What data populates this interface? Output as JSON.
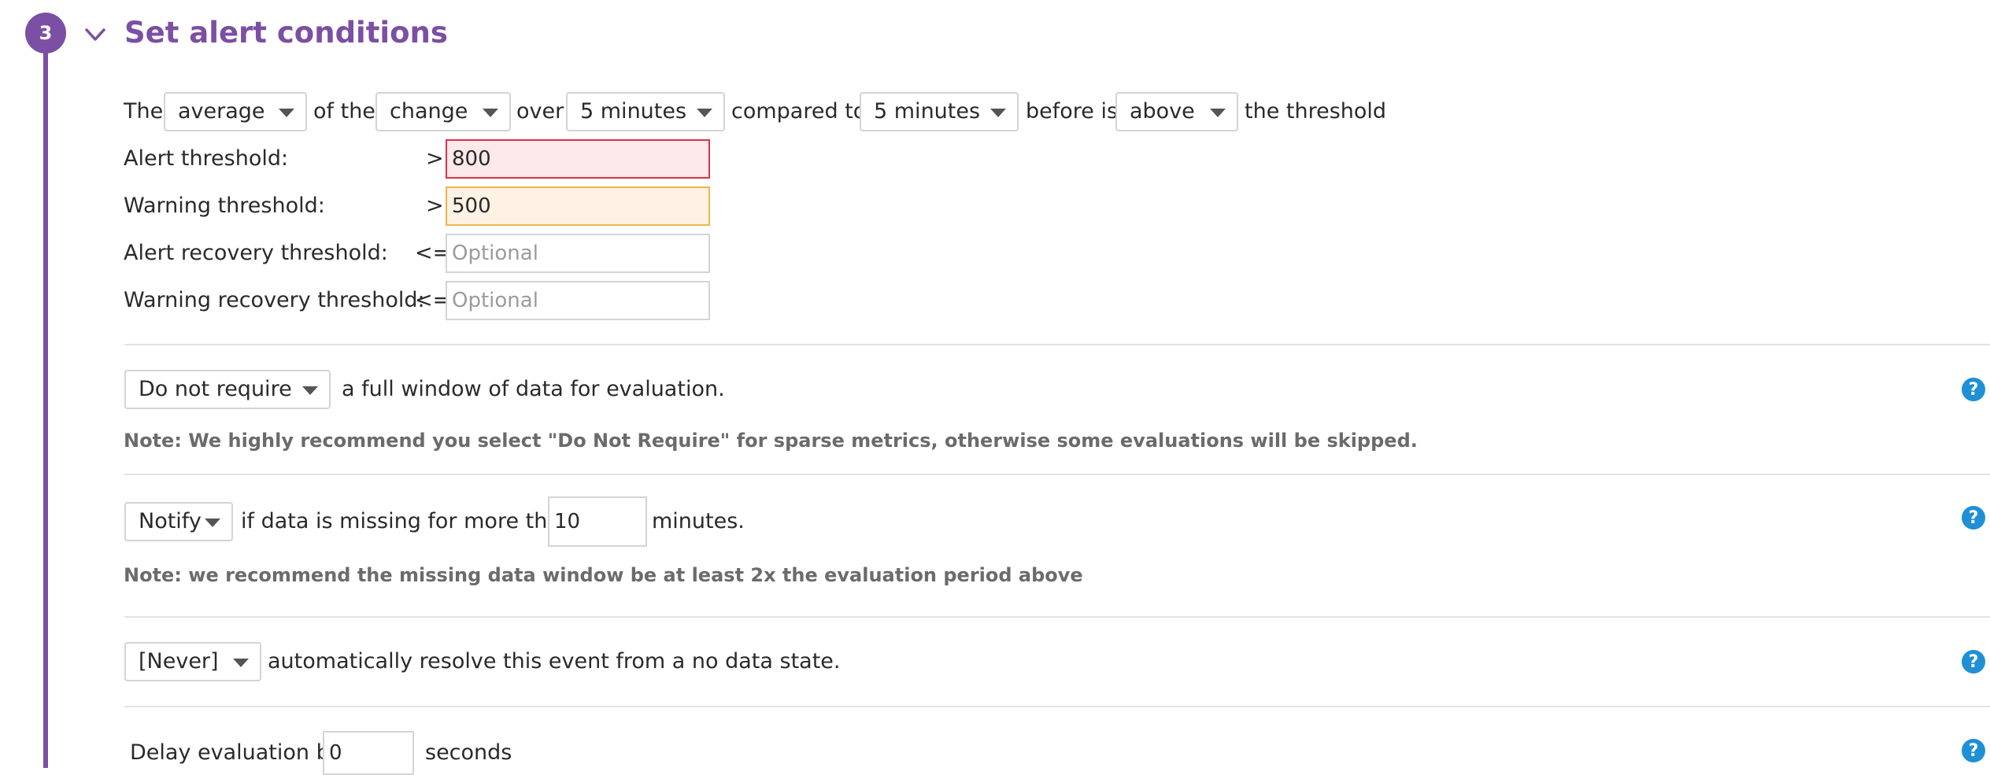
{
  "section": {
    "step": "3",
    "title": "Set alert conditions"
  },
  "condition": {
    "word_the": "The",
    "aggregation": "average",
    "word_of_the": "of the",
    "metric_mode": "change",
    "word_over": "over",
    "window": "5 minutes",
    "word_compared_to": "compared to",
    "compare_window": "5 minutes",
    "word_before_is": "before is",
    "comparator": "above",
    "word_the_threshold": "the threshold"
  },
  "thresholds": {
    "alert_label": "Alert threshold:",
    "alert_op": ">",
    "alert_value": "800",
    "warning_label": "Warning threshold:",
    "warning_op": ">",
    "warning_value": "500",
    "alert_recovery_label": "Alert recovery threshold:",
    "alert_recovery_op": "<=",
    "warning_recovery_label": "Warning recovery threshold:",
    "warning_recovery_op": "<=",
    "placeholder": "Optional"
  },
  "full_window": {
    "select": "Do not require",
    "text": "a full window of data for evaluation.",
    "note": "Note: We highly recommend you select \"Do Not Require\" for sparse metrics, otherwise some evaluations will be skipped."
  },
  "missing_data": {
    "select": "Notify",
    "text_before": "if data is missing for more than",
    "minutes": "10",
    "text_after": "minutes.",
    "note": "Note: we recommend the missing data window be at least 2x the evaluation period above"
  },
  "auto_resolve": {
    "select": "[Never]",
    "text": "automatically resolve this event from a no data state."
  },
  "delay": {
    "text_before": "Delay evaluation by",
    "seconds": "0",
    "text_after": "seconds"
  },
  "help_glyph": "?",
  "colors": {
    "accent": "#7b4fa3",
    "help": "#1f8fd6",
    "alert": "#d9334a",
    "warning": "#f0b64a"
  }
}
